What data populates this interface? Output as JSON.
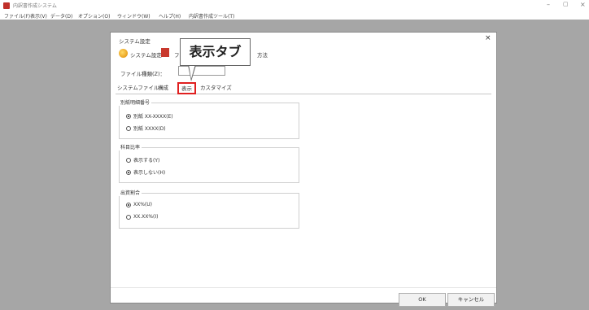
{
  "window": {
    "title": "内訳書作成システム",
    "controls": {
      "minimize": "–",
      "maximize": "▢",
      "close": "×"
    }
  },
  "menubar": {
    "items": [
      "ファイル(F)",
      "表示(V)",
      "データ(D)",
      "オプション(O)",
      "ウィンドウ(W)",
      "ヘルプ(H)",
      "内訳書作成ツール(T)"
    ]
  },
  "dialog": {
    "title": "システム設定",
    "close": "×",
    "header_items": [
      "システム設定",
      "ファ",
      "方法"
    ],
    "file_type_label": "ファイル種類(Z)：",
    "file_type_value": "",
    "tabs": [
      "システムファイル",
      "構成",
      "表示",
      "カスタマイズ"
    ],
    "active_tab": "表示",
    "callout_text": "表示タブ",
    "groups": [
      {
        "title": "別紙明細番号",
        "options": [
          {
            "label": "別紙 XX-XXXX(E)",
            "selected": true
          },
          {
            "label": "別紙 XXXX(D)",
            "selected": false
          }
        ]
      },
      {
        "title": "科目比率",
        "options": [
          {
            "label": "表示する(Y)",
            "selected": false
          },
          {
            "label": "表示しない(H)",
            "selected": true
          }
        ]
      },
      {
        "title": "出資割合",
        "options": [
          {
            "label": "XX%(U)",
            "selected": true
          },
          {
            "label": "XX.XX%(I)",
            "selected": false
          }
        ]
      }
    ],
    "buttons": {
      "ok": "OK",
      "cancel": "キャンセル"
    }
  },
  "colors": {
    "highlight": "#e02020",
    "workspace": "#a6a6a6"
  }
}
